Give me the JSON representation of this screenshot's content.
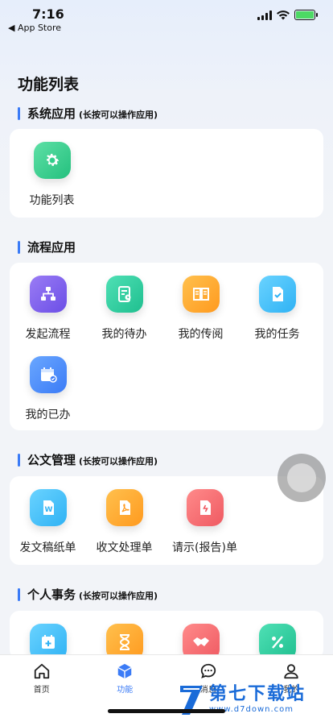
{
  "status_bar": {
    "time": "7:16",
    "back_label": "◀ App Store"
  },
  "page_title": "功能列表",
  "sections": {
    "system": {
      "title": "系统应用",
      "hint": "(长按可以操作应用)",
      "items": [
        {
          "label": "功能列表",
          "icon": "gear-icon"
        }
      ]
    },
    "flow": {
      "title": "流程应用",
      "items": [
        {
          "label": "发起流程",
          "icon": "flowchart-icon"
        },
        {
          "label": "我的待办",
          "icon": "todo-doc-icon"
        },
        {
          "label": "我的传阅",
          "icon": "book-icon"
        },
        {
          "label": "我的任务",
          "icon": "task-check-icon"
        },
        {
          "label": "我的已办",
          "icon": "calendar-check-icon"
        }
      ]
    },
    "official_docs": {
      "title": "公文管理",
      "hint": "(长按可以操作应用)",
      "items": [
        {
          "label": "发文稿纸单",
          "icon": "word-doc-icon"
        },
        {
          "label": "收文处理单",
          "icon": "pdf-doc-icon"
        },
        {
          "label": "请示(报告)单",
          "icon": "report-doc-icon"
        }
      ]
    },
    "personal": {
      "title": "个人事务",
      "hint": "(长按可以操作应用)",
      "items": [
        {
          "label": "",
          "icon": "calendar-add-icon"
        },
        {
          "label": "",
          "icon": "hourglass-icon"
        },
        {
          "label": "",
          "icon": "handshake-icon"
        },
        {
          "label": "",
          "icon": "percent-icon"
        }
      ]
    }
  },
  "tabbar": {
    "tabs": [
      {
        "label": "首页",
        "icon": "home-icon",
        "active": false
      },
      {
        "label": "功能",
        "icon": "cube-icon",
        "active": true
      },
      {
        "label": "消息",
        "icon": "chat-icon",
        "active": false
      },
      {
        "label": "我的",
        "icon": "user-icon",
        "active": false
      }
    ]
  },
  "watermark": {
    "title": "第七下载站",
    "url": "www.d7down.com"
  },
  "colors": {
    "accent": "#3b7bf6",
    "card_bg": "#ffffff",
    "page_bg": "#f2f4f8"
  }
}
